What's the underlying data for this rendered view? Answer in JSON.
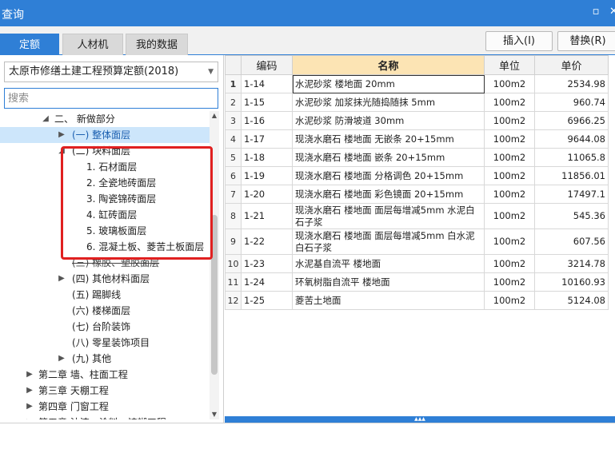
{
  "window": {
    "title": "查询",
    "restore_glyph": "▫",
    "close_glyph": "✕"
  },
  "tabs": [
    {
      "label": "定额",
      "active": true
    },
    {
      "label": "人材机",
      "active": false
    },
    {
      "label": "我的数据",
      "active": false
    }
  ],
  "actions": {
    "insert_label": "插入(I)",
    "replace_label": "替换(R)"
  },
  "left": {
    "dropdown_value": "太原市修缮土建工程预算定额(2018)",
    "search_placeholder": "搜索",
    "tree": [
      {
        "label": "二、 新做部分",
        "toggle": "◢",
        "level": 0
      },
      {
        "label": "(一) 整体面层",
        "toggle": "▶",
        "level": 1,
        "selected": true
      },
      {
        "label": "(二) 块料面层",
        "toggle": "◢",
        "level": 1
      },
      {
        "label": "1. 石材面层",
        "toggle": "",
        "level": 2
      },
      {
        "label": "2. 全瓷地砖面层",
        "toggle": "",
        "level": 2
      },
      {
        "label": "3. 陶瓷锦砖面层",
        "toggle": "",
        "level": 2
      },
      {
        "label": "4. 缸砖面层",
        "toggle": "",
        "level": 2
      },
      {
        "label": "5. 玻璃板面层",
        "toggle": "",
        "level": 2
      },
      {
        "label": "6. 混凝土板、菱苦土板面层",
        "toggle": "",
        "level": 2
      },
      {
        "label": "(三) 橡胶、塑胶面层",
        "toggle": "",
        "level": 1,
        "struck": true
      },
      {
        "label": "(四) 其他材料面层",
        "toggle": "▶",
        "level": 1
      },
      {
        "label": "(五) 踢脚线",
        "toggle": "",
        "level": 1
      },
      {
        "label": "(六) 楼梯面层",
        "toggle": "",
        "level": 1
      },
      {
        "label": "(七) 台阶装饰",
        "toggle": "",
        "level": 1
      },
      {
        "label": "(八) 零星装饰项目",
        "toggle": "",
        "level": 1
      },
      {
        "label": "(九) 其他",
        "toggle": "▶",
        "level": 1
      },
      {
        "label": "第二章 墙、柱面工程",
        "toggle": "▶",
        "level": -1
      },
      {
        "label": "第三章 天棚工程",
        "toggle": "▶",
        "level": -1
      },
      {
        "label": "第四章 门窗工程",
        "toggle": "▶",
        "level": -1
      },
      {
        "label": "第五章 油漆、涂料、裱糊工程",
        "toggle": "▶",
        "level": -1
      }
    ]
  },
  "grid": {
    "columns": [
      "编码",
      "名称",
      "单位",
      "单价"
    ],
    "rows": [
      {
        "n": "1",
        "code": "1-14",
        "name": "水泥砂浆 楼地面 20mm",
        "unit": "100m2",
        "price": "2534.98",
        "active": true
      },
      {
        "n": "2",
        "code": "1-15",
        "name": "水泥砂浆 加浆抹光随捣随抹 5mm",
        "unit": "100m2",
        "price": "960.74"
      },
      {
        "n": "3",
        "code": "1-16",
        "name": "水泥砂浆 防滑坡道 30mm",
        "unit": "100m2",
        "price": "6966.25"
      },
      {
        "n": "4",
        "code": "1-17",
        "name": "现浇水磨石 楼地面 无嵌条 20+15mm",
        "unit": "100m2",
        "price": "9644.08"
      },
      {
        "n": "5",
        "code": "1-18",
        "name": "现浇水磨石 楼地面 嵌条 20+15mm",
        "unit": "100m2",
        "price": "11065.8"
      },
      {
        "n": "6",
        "code": "1-19",
        "name": "现浇水磨石 楼地面 分格调色 20+15mm",
        "unit": "100m2",
        "price": "11856.01"
      },
      {
        "n": "7",
        "code": "1-20",
        "name": "现浇水磨石 楼地面 彩色镜面 20+15mm",
        "unit": "100m2",
        "price": "17497.1"
      },
      {
        "n": "8",
        "code": "1-21",
        "name": "现浇水磨石 楼地面 面层每增减5mm 水泥白石子浆",
        "unit": "100m2",
        "price": "545.36",
        "tall": true
      },
      {
        "n": "9",
        "code": "1-22",
        "name": "现浇水磨石 楼地面 面层每增减5mm 白水泥白石子浆",
        "unit": "100m2",
        "price": "607.56",
        "tall": true
      },
      {
        "n": "10",
        "code": "1-23",
        "name": "水泥基自流平 楼地面",
        "unit": "100m2",
        "price": "3214.78"
      },
      {
        "n": "11",
        "code": "1-24",
        "name": "环氧树脂自流平 楼地面",
        "unit": "100m2",
        "price": "10160.93"
      },
      {
        "n": "12",
        "code": "1-25",
        "name": "菱苦土地面",
        "unit": "100m2",
        "price": "5124.08"
      }
    ]
  }
}
